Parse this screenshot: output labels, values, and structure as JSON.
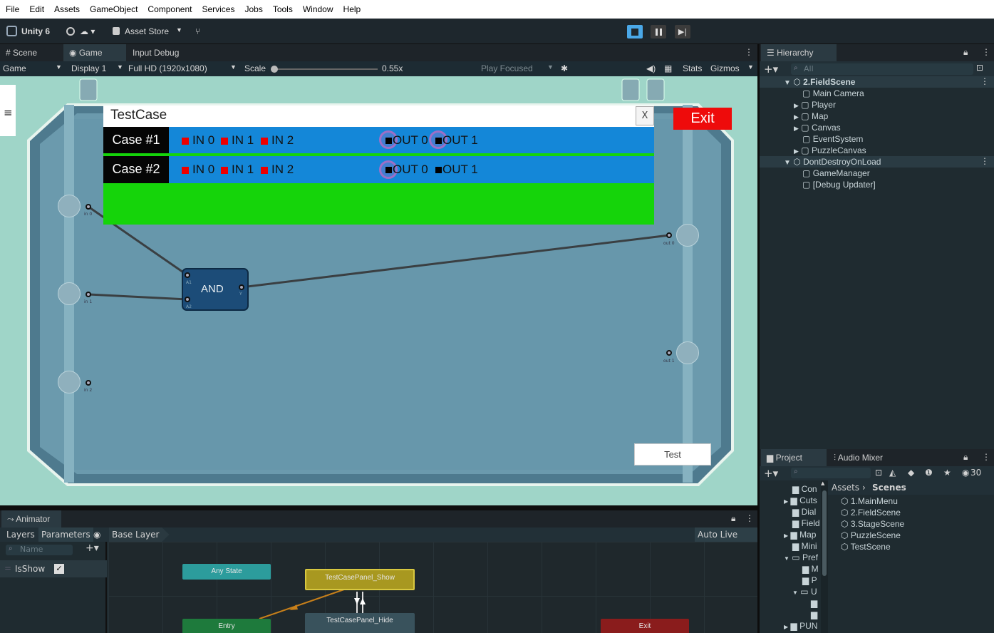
{
  "menu": [
    "File",
    "Edit",
    "Assets",
    "GameObject",
    "Component",
    "Services",
    "Jobs",
    "Tools",
    "Window",
    "Help"
  ],
  "toolbar": {
    "unity_label": "Unity 6",
    "asset_store": "Asset Store"
  },
  "tabs": {
    "scene": "Scene",
    "game": "Game",
    "input_debug": "Input Debug"
  },
  "gamebar": {
    "mode": "Game",
    "display": "Display 1",
    "resolution": "Full HD (1920x1080)",
    "scale_label": "Scale",
    "scale_value": "0.55x",
    "play_focused": "Play Focused",
    "stats": "Stats",
    "gizmos": "Gizmos"
  },
  "game": {
    "panel_title": "TestCase",
    "close_label": "X",
    "exit_label": "Exit",
    "case1": "Case #1",
    "case2": "Case #2",
    "in0": "IN 0",
    "in1": "IN 1",
    "in2": "IN 2",
    "out0": "OUT 0",
    "out1": "OUT 1",
    "gate": "AND",
    "test_label": "Test",
    "port_in0": "in 0",
    "port_in1": "in 1",
    "port_in2": "in 2",
    "port_out0": "out 0",
    "port_out1": "out 1",
    "gate_a1": "A1",
    "gate_a2": "A2",
    "gate_y": "Y"
  },
  "hierarchy": {
    "title": "Hierarchy",
    "search_placeholder": "All",
    "items": [
      "2.FieldScene",
      "Main Camera",
      "Player",
      "Map",
      "Canvas",
      "EventSystem",
      "PuzzleCanvas",
      "DontDestroyOnLoad",
      "GameManager",
      "[Debug Updater]"
    ]
  },
  "project": {
    "tab": "Project",
    "tab2": "Audio Mixer",
    "count": "30",
    "breadcrumb_root": "Assets",
    "breadcrumb_leaf": "Scenes",
    "tree": [
      "Con",
      "Cuts",
      "Dial",
      "Field",
      "Map",
      "Mini",
      "Pref",
      "M",
      "P",
      "U",
      "PUN"
    ],
    "files": [
      "1.MainMenu",
      "2.FieldScene",
      "3.StageScene",
      "PuzzleScene",
      "TestScene"
    ]
  },
  "animator": {
    "title": "Animator",
    "layers": "Layers",
    "parameters": "Parameters",
    "base_layer": "Base Layer",
    "auto_live": "Auto Live Link",
    "name_placeholder": "Name",
    "param": "IsShow",
    "nodes": {
      "any": "Any State",
      "show": "TestCasePanel_Show",
      "hide": "TestCasePanel_Hide",
      "entry": "Entry",
      "exit": "Exit"
    }
  },
  "colors": {
    "case_bar": "#1487d8",
    "result_bar": "#15d40a",
    "exit_btn": "#ee0b0b",
    "playing": "#4aa8e8"
  }
}
